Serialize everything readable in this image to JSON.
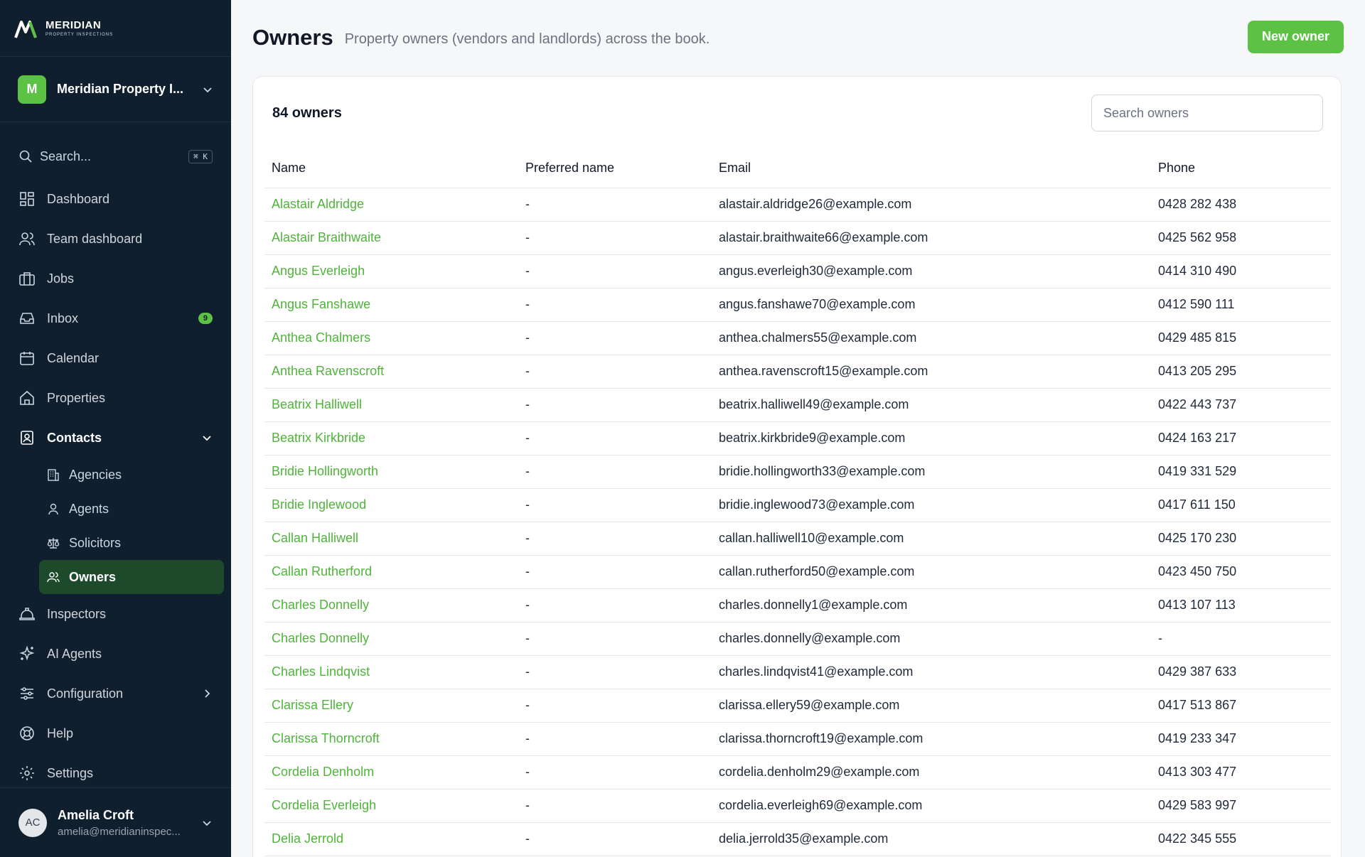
{
  "brand": {
    "name": "MERIDIAN",
    "sub": "PROPERTY INSPECTIONS",
    "accent": "#5bc244"
  },
  "org": {
    "initial": "M",
    "name": "Meridian Property I..."
  },
  "search": {
    "label": "Search...",
    "shortcut": "⌘ K"
  },
  "nav": [
    {
      "label": "Dashboard",
      "icon": "dashboard-icon"
    },
    {
      "label": "Team dashboard",
      "icon": "team-icon"
    },
    {
      "label": "Jobs",
      "icon": "briefcase-icon"
    },
    {
      "label": "Inbox",
      "icon": "inbox-icon",
      "badge": "9"
    },
    {
      "label": "Calendar",
      "icon": "calendar-icon"
    },
    {
      "label": "Properties",
      "icon": "home-icon"
    },
    {
      "label": "Contacts",
      "icon": "contacts-icon"
    }
  ],
  "subnav": [
    {
      "label": "Agencies",
      "icon": "building-icon"
    },
    {
      "label": "Agents",
      "icon": "person-icon"
    },
    {
      "label": "Solicitors",
      "icon": "scales-icon"
    },
    {
      "label": "Owners",
      "icon": "people-icon"
    }
  ],
  "nav2": [
    {
      "label": "Inspectors",
      "icon": "hardhat-icon"
    },
    {
      "label": "AI Agents",
      "icon": "sparkle-icon"
    },
    {
      "label": "Configuration",
      "icon": "sliders-icon"
    },
    {
      "label": "Help",
      "icon": "lifebuoy-icon"
    },
    {
      "label": "Settings",
      "icon": "gear-icon"
    }
  ],
  "user": {
    "initials": "AC",
    "name": "Amelia Croft",
    "email": "amelia@meridianinspec..."
  },
  "header": {
    "title": "Owners",
    "subtitle": "Property owners (vendors and landlords) across the book.",
    "new_button": "New owner"
  },
  "table": {
    "count": "84 owners",
    "search_placeholder": "Search owners",
    "columns": [
      "Name",
      "Preferred name",
      "Email",
      "Phone"
    ],
    "rows": [
      [
        "Alastair Aldridge",
        "-",
        "alastair.aldridge26@example.com",
        "0428 282 438"
      ],
      [
        "Alastair Braithwaite",
        "-",
        "alastair.braithwaite66@example.com",
        "0425 562 958"
      ],
      [
        "Angus Everleigh",
        "-",
        "angus.everleigh30@example.com",
        "0414 310 490"
      ],
      [
        "Angus Fanshawe",
        "-",
        "angus.fanshawe70@example.com",
        "0412 590 111"
      ],
      [
        "Anthea Chalmers",
        "-",
        "anthea.chalmers55@example.com",
        "0429 485 815"
      ],
      [
        "Anthea Ravenscroft",
        "-",
        "anthea.ravenscroft15@example.com",
        "0413 205 295"
      ],
      [
        "Beatrix Halliwell",
        "-",
        "beatrix.halliwell49@example.com",
        "0422 443 737"
      ],
      [
        "Beatrix Kirkbride",
        "-",
        "beatrix.kirkbride9@example.com",
        "0424 163 217"
      ],
      [
        "Bridie Hollingworth",
        "-",
        "bridie.hollingworth33@example.com",
        "0419 331 529"
      ],
      [
        "Bridie Inglewood",
        "-",
        "bridie.inglewood73@example.com",
        "0417 611 150"
      ],
      [
        "Callan Halliwell",
        "-",
        "callan.halliwell10@example.com",
        "0425 170 230"
      ],
      [
        "Callan Rutherford",
        "-",
        "callan.rutherford50@example.com",
        "0423 450 750"
      ],
      [
        "Charles Donnelly",
        "-",
        "charles.donnelly1@example.com",
        "0413 107 113"
      ],
      [
        "Charles Donnelly",
        "-",
        "charles.donnelly@example.com",
        "-"
      ],
      [
        "Charles Lindqvist",
        "-",
        "charles.lindqvist41@example.com",
        "0429 387 633"
      ],
      [
        "Clarissa Ellery",
        "-",
        "clarissa.ellery59@example.com",
        "0417 513 867"
      ],
      [
        "Clarissa Thorncroft",
        "-",
        "clarissa.thorncroft19@example.com",
        "0419 233 347"
      ],
      [
        "Cordelia Denholm",
        "-",
        "cordelia.denholm29@example.com",
        "0413 303 477"
      ],
      [
        "Cordelia Everleigh",
        "-",
        "cordelia.everleigh69@example.com",
        "0429 583 997"
      ],
      [
        "Delia Jerrold",
        "-",
        "delia.jerrold35@example.com",
        "0422 345 555"
      ]
    ]
  }
}
